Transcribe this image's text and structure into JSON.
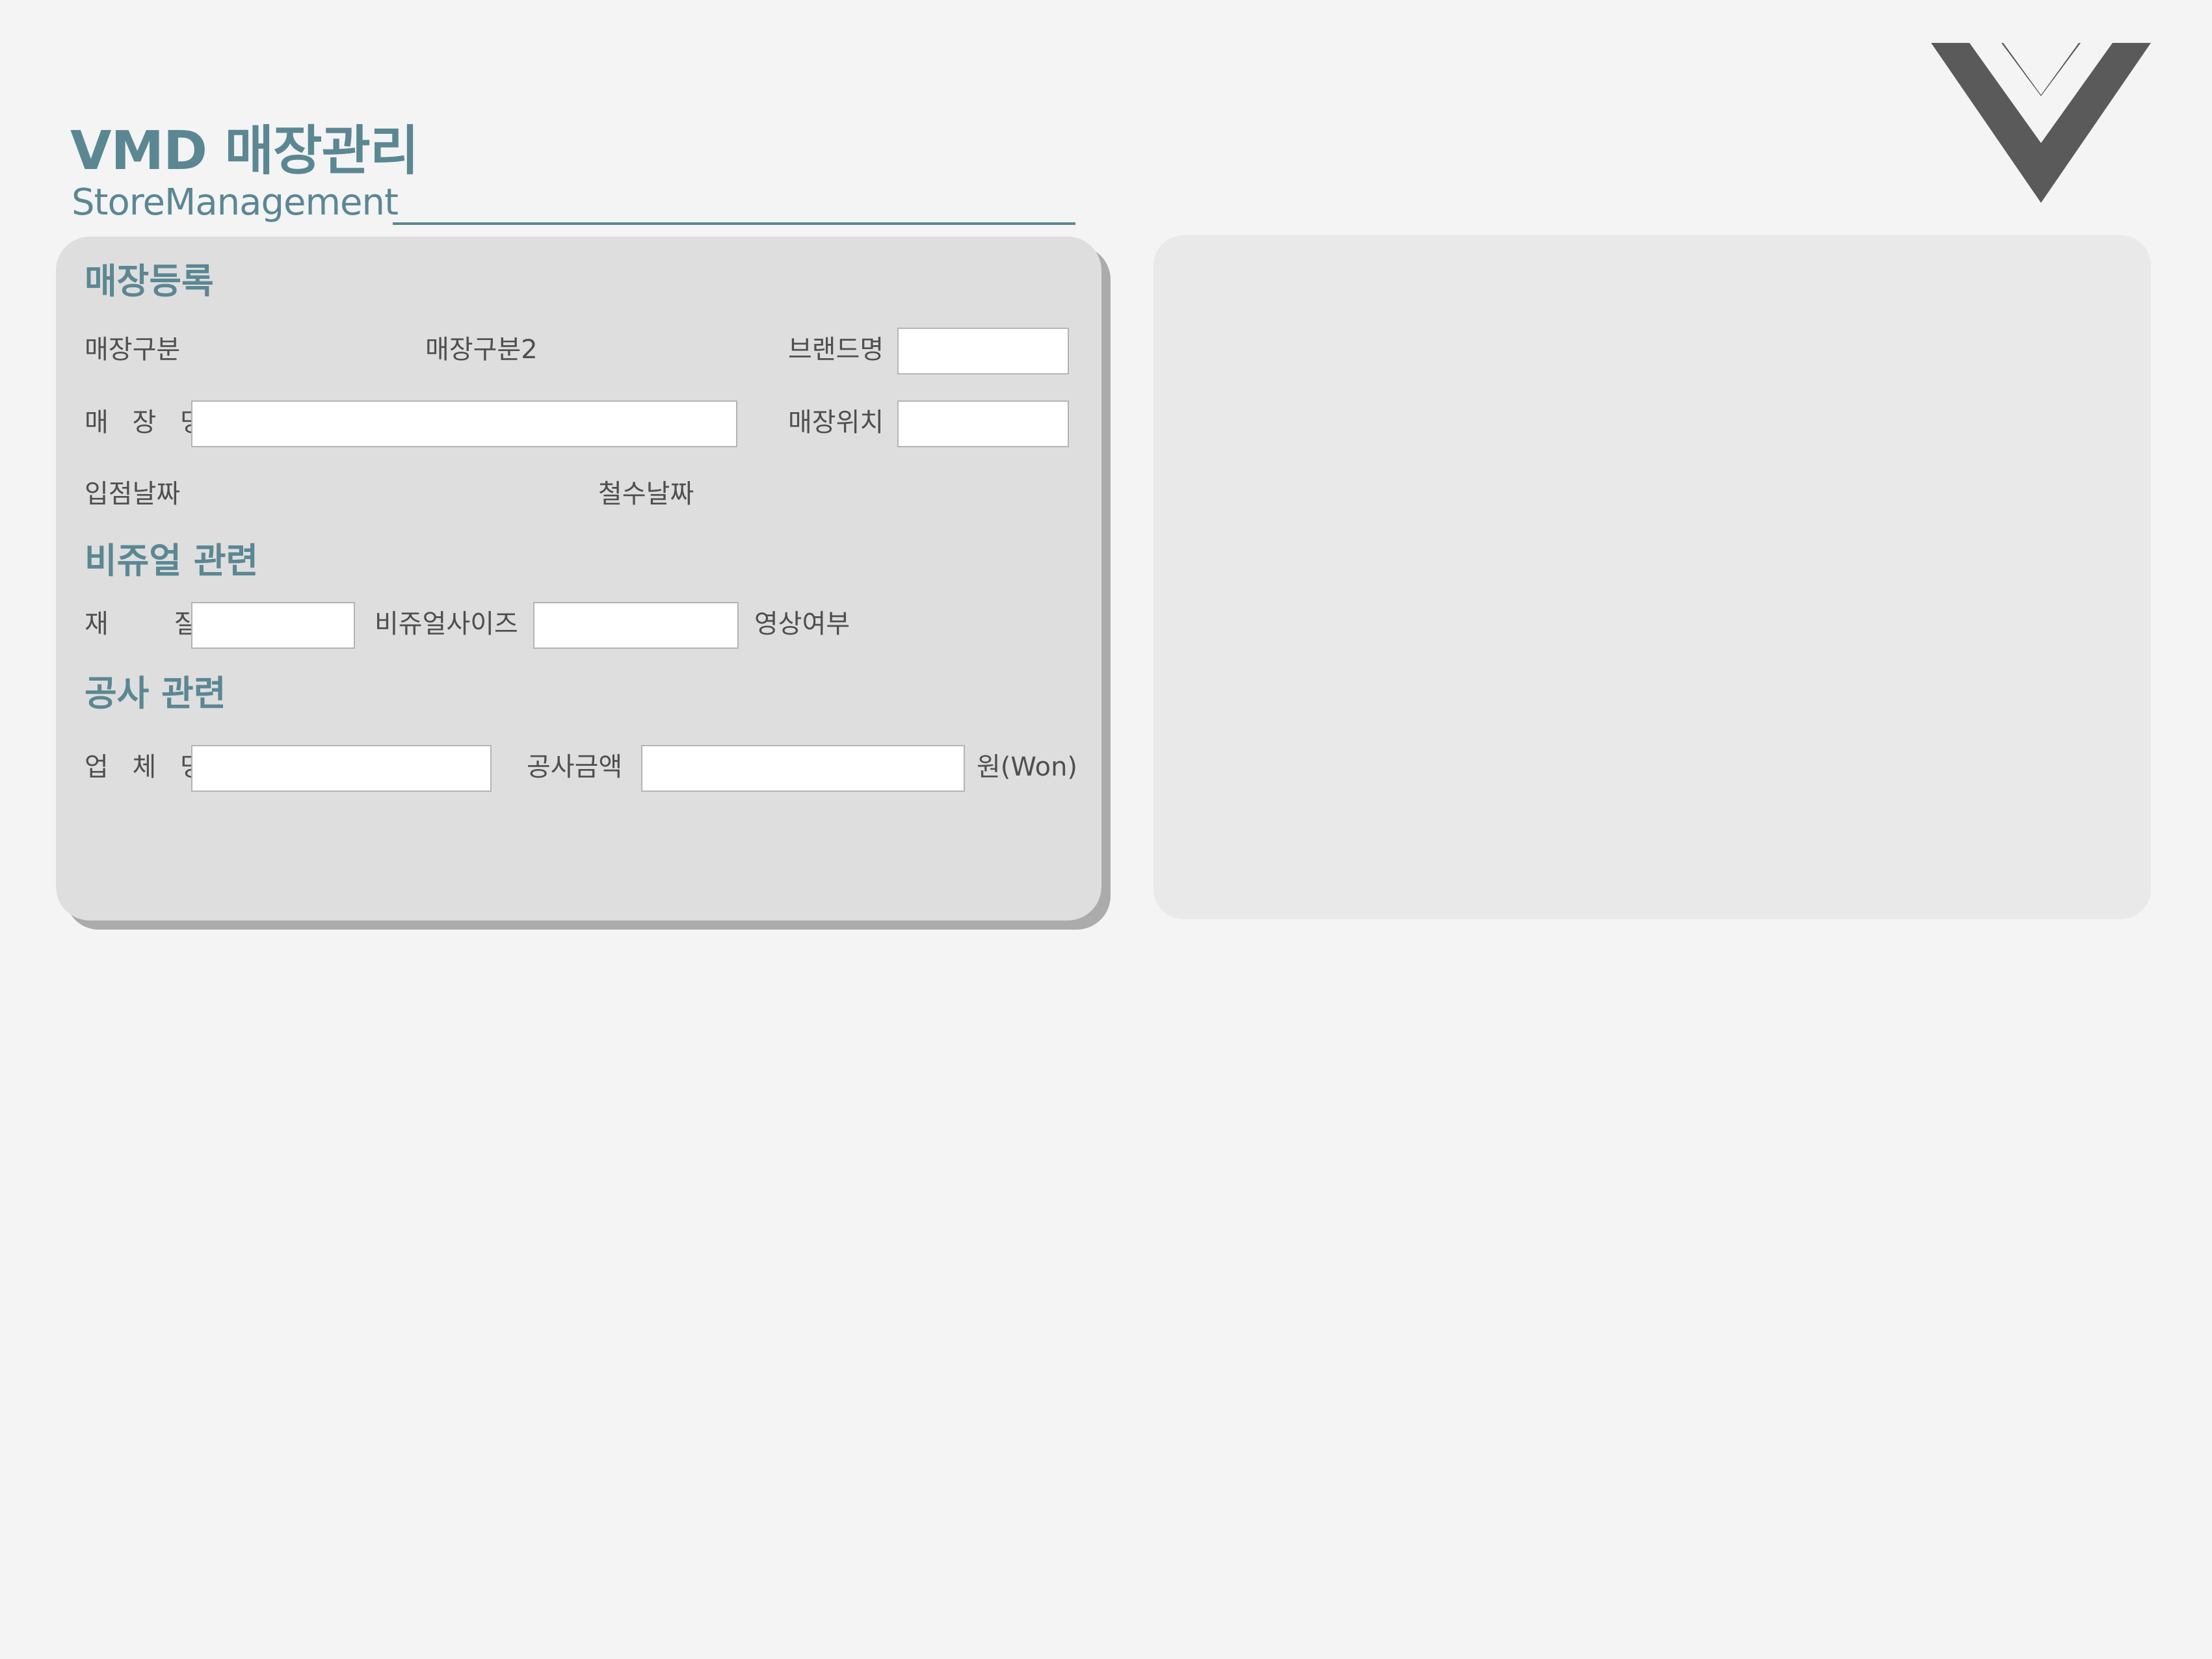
{
  "header": {
    "title": "VMD 매장관리",
    "subtitle": "StoreManagement"
  },
  "logo": {
    "icon": "v-chevron-logo",
    "color": "#5a5a5a"
  },
  "colors": {
    "accent": "#5b8793",
    "label": "#4f4f4f",
    "form_panel": "#dedede",
    "preview_panel": "#e9e9e9"
  },
  "store_registration": {
    "heading": "매장등록",
    "store_type_label": "매장구분",
    "store_type2_label": "매장구분2",
    "brand_name_label": "브랜드명",
    "brand_name_value": "",
    "store_name_label": "매 장 명",
    "store_name_value": "",
    "store_location_label": "매장위치",
    "store_location_value": "",
    "open_date_label": "입점날짜",
    "close_date_label": "철수날짜"
  },
  "visual": {
    "heading": "비쥬얼 관련",
    "material_label": "재 질",
    "material_value": "",
    "visual_size_label": "비쥬얼사이즈",
    "visual_size_value": "",
    "video_label": "영상여부"
  },
  "construction": {
    "heading": "공사 관련",
    "company_label": "업 체 명",
    "company_value": "",
    "amount_label": "공사금액",
    "amount_value": "",
    "currency_label": "원(Won)"
  }
}
